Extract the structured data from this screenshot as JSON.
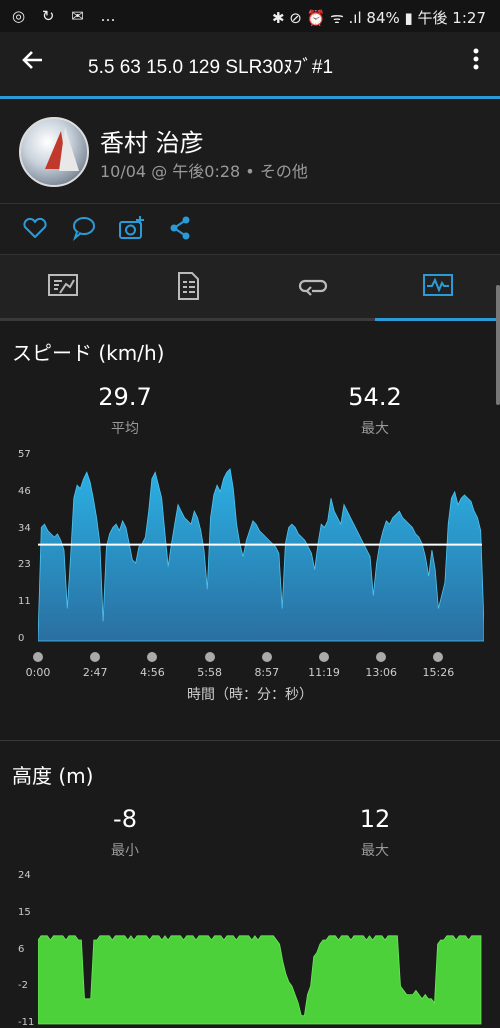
{
  "status": {
    "left_icons": "◎ ↻ ✉ …",
    "right": "✱ ⊘ ⏰ ᯤ .ıl 84% ▮ 午後 1:27"
  },
  "appbar": {
    "title": "5.5   63   15.0   129   SLR30ﾇﾌﾞ#1"
  },
  "user": {
    "name": "香村 治彦",
    "subtitle": "10/04 @ 午後0:28 • その他"
  },
  "actions": [
    "like-icon",
    "comment-icon",
    "camera-plus-icon",
    "share-icon"
  ],
  "tabs": [
    "summary-icon",
    "details-icon",
    "laps-icon",
    "charts-icon"
  ],
  "speed": {
    "title": "スピード (km/h)",
    "avg_value": "29.7",
    "avg_label": "平均",
    "max_value": "54.2",
    "max_label": "最大",
    "x_axis_title": "時間（時：分：秒）"
  },
  "altitude": {
    "title": "高度 (m)",
    "min_value": "-8",
    "min_label": "最小",
    "max_value": "12",
    "max_label": "最大"
  },
  "colors": {
    "accent": "#2b9bd8",
    "speed_fill": "#2aa3d8",
    "altitude_fill": "#4cd13a"
  },
  "chart_data": [
    {
      "type": "area",
      "title": "スピード (km/h)",
      "xlabel": "時間（時：分：秒）",
      "ylabel": "",
      "yticks": [
        "57",
        "46",
        "34",
        "23",
        "11",
        "0"
      ],
      "ylim": [
        0,
        57
      ],
      "xticks": [
        "0:00",
        "2:47",
        "4:56",
        "5:58",
        "8:57",
        "11:19",
        "13:06",
        "15:26"
      ],
      "reference_line": {
        "value": 29.7
      },
      "values": [
        1,
        35,
        36,
        34,
        33,
        32,
        33,
        31,
        28,
        10,
        26,
        44,
        48,
        47,
        50,
        52,
        49,
        44,
        38,
        30,
        6,
        29,
        33,
        35,
        36,
        34,
        37,
        35,
        30,
        25,
        24,
        29,
        30,
        32,
        40,
        50,
        52,
        48,
        44,
        33,
        23,
        30,
        36,
        42,
        40,
        38,
        37,
        36,
        40,
        38,
        34,
        28,
        16,
        38,
        45,
        48,
        46,
        50,
        52,
        53,
        47,
        36,
        30,
        26,
        31,
        34,
        37,
        36,
        34,
        33,
        32,
        31,
        30,
        29,
        27,
        10,
        30,
        35,
        36,
        35,
        33,
        32,
        31,
        29,
        27,
        22,
        30,
        36,
        35,
        37,
        44,
        40,
        38,
        36,
        42,
        40,
        38,
        36,
        34,
        32,
        30,
        28,
        26,
        14,
        24,
        30,
        34,
        37,
        36,
        38,
        39,
        40,
        38,
        37,
        36,
        35,
        33,
        32,
        30,
        26,
        20,
        28,
        22,
        10,
        14,
        18,
        36,
        44,
        46,
        42,
        44,
        45,
        44,
        43,
        40,
        38,
        34,
        5
      ]
    },
    {
      "type": "area",
      "title": "高度 (m)",
      "yticks": [
        "24",
        "15",
        "6",
        "-2",
        "-11"
      ],
      "ylim": [
        -11,
        24
      ],
      "values": [
        9,
        10,
        10,
        10,
        9,
        10,
        10,
        10,
        10,
        9,
        10,
        10,
        10,
        9,
        9,
        -5,
        -5,
        -5,
        9,
        9,
        10,
        10,
        10,
        10,
        9,
        10,
        10,
        10,
        10,
        9,
        10,
        9,
        10,
        10,
        10,
        10,
        9,
        10,
        10,
        10,
        9,
        10,
        9,
        10,
        10,
        10,
        10,
        9,
        10,
        10,
        10,
        9,
        10,
        10,
        10,
        10,
        9,
        10,
        10,
        10,
        9,
        10,
        10,
        10,
        9,
        10,
        10,
        10,
        10,
        9,
        10,
        9,
        10,
        10,
        10,
        10,
        10,
        9,
        8,
        4,
        1,
        -1,
        -2,
        -4,
        -6,
        -9,
        -9,
        -4,
        -2,
        5,
        6,
        8,
        9,
        9,
        10,
        10,
        10,
        9,
        10,
        10,
        10,
        9,
        10,
        10,
        10,
        10,
        9,
        10,
        9,
        10,
        10,
        10,
        9,
        10,
        10,
        10,
        10,
        -2,
        -3,
        -4,
        -4,
        -4,
        -3,
        -4,
        -5,
        -4,
        -5,
        -5,
        -6,
        8,
        9,
        9,
        10,
        10,
        10,
        9,
        10,
        10,
        10,
        9,
        10,
        10,
        10,
        10
      ]
    }
  ]
}
